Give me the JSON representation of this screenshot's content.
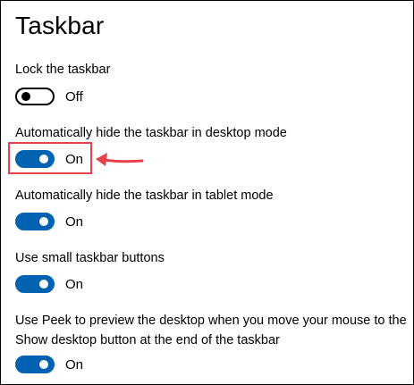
{
  "page": {
    "title": "Taskbar"
  },
  "settings": [
    {
      "label": "Lock the taskbar",
      "state": "Off",
      "on": false
    },
    {
      "label": "Automatically hide the taskbar in desktop mode",
      "state": "On",
      "on": true
    },
    {
      "label": "Automatically hide the taskbar in tablet mode",
      "state": "On",
      "on": true
    },
    {
      "label": "Use small taskbar buttons",
      "state": "On",
      "on": true
    },
    {
      "label": "Use Peek to preview the desktop when you move your mouse to the Show desktop button at the end of the taskbar",
      "state": "On",
      "on": true
    }
  ],
  "colors": {
    "accent": "#0063b1",
    "annotation": "#e8414a"
  }
}
